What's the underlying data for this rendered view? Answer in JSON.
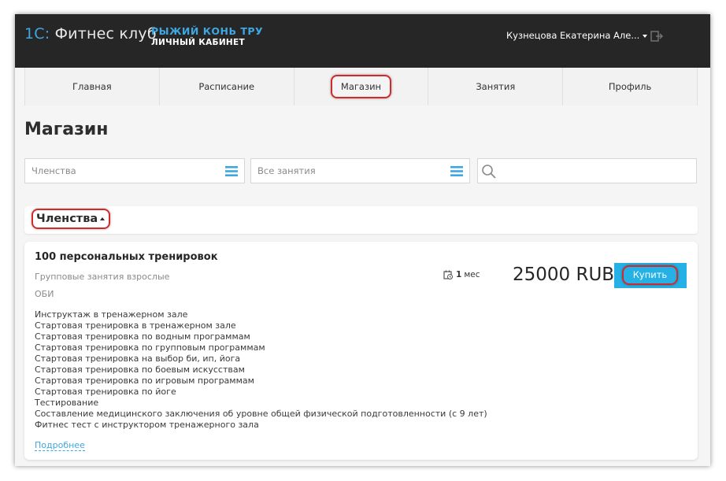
{
  "header": {
    "logo_prefix": "1С:",
    "logo_text": "Фитнес клуб",
    "club_name": "РЫЖИЙ КОНЬ ТРУ",
    "club_subtitle": "ЛИЧНЫЙ КАБИНЕТ",
    "user_name": "Кузнецова Екатерина Але...",
    "logout_icon": "logout-icon"
  },
  "nav": {
    "items": [
      {
        "label": "Главная"
      },
      {
        "label": "Расписание"
      },
      {
        "label": "Магазин",
        "active": true
      },
      {
        "label": "Занятия"
      },
      {
        "label": "Профиль"
      }
    ]
  },
  "page": {
    "title": "Магазин"
  },
  "filters": {
    "category_value": "Членства",
    "activity_value": "Все занятия",
    "search_placeholder": ""
  },
  "section": {
    "title": "Членства"
  },
  "product": {
    "title": "100 персональных тренировок",
    "group": "Групповые занятия взрослые",
    "location": "ОБИ",
    "services": [
      "Инструктаж в тренажерном зале",
      "Стартовая тренировка в тренажерном зале",
      "Стартовая тренировка по водным программам",
      "Стартовая тренировка по групповым программам",
      "Стартовая тренировка на выбор би, ип, йога",
      "Стартовая тренировка по боевым искусствам",
      "Стартовая тренировка по игровым программам",
      "Стартовая тренировка по йоге",
      "Тестирование",
      "Составление медицинского заключения об уровне общей физической подготовленности (с 9 лет)",
      "Фитнес тест с инструктором тренажерного зала"
    ],
    "more_label": "Подробнее",
    "duration_value": "1",
    "duration_unit": "мес",
    "price": "25000 RUB",
    "buy_label": "Купить"
  },
  "colors": {
    "accent": "#3ea7e2",
    "button": "#26b1e6",
    "header_bg": "#262626",
    "highlight": "#d22a2a"
  }
}
